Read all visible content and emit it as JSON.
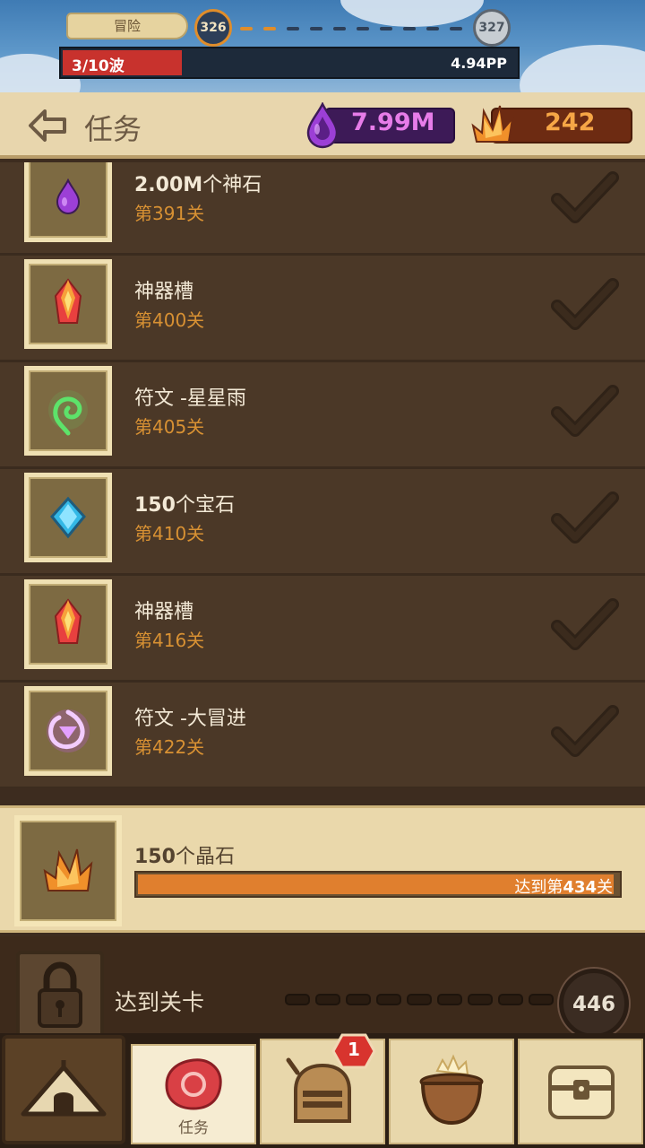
{
  "adventure": {
    "tag": "冒险",
    "current_level": "326",
    "next_level": "327",
    "wave": "3/10波",
    "wave_fraction": 0.3,
    "pp": "4.94PP"
  },
  "header": {
    "title": "任务",
    "purple_resource": "7.99M",
    "orange_resource": "242"
  },
  "quests": [
    {
      "title_bold": "2.00M",
      "title_rest": "个神石",
      "stage": "第391关",
      "icon": "purple-drop-icon",
      "done": true
    },
    {
      "title_bold": "",
      "title_rest": "神器槽",
      "stage": "第400关",
      "icon": "red-gem-icon",
      "done": true
    },
    {
      "title_bold": "",
      "title_rest": "符文 -星星雨",
      "stage": "第405关",
      "icon": "green-swirl-rune-icon",
      "done": true
    },
    {
      "title_bold": "150",
      "title_rest": "个宝石",
      "stage": "第410关",
      "icon": "blue-gem-icon",
      "done": true
    },
    {
      "title_bold": "",
      "title_rest": "神器槽",
      "stage": "第416关",
      "icon": "red-gem-icon",
      "done": true
    },
    {
      "title_bold": "",
      "title_rest": "符文 -大冒进",
      "stage": "第422关",
      "icon": "purple-rune-icon",
      "done": true
    }
  ],
  "current_quest": {
    "title_bold": "150",
    "title_rest": "个晶石",
    "progress_prefix": "达到第",
    "progress_level": "434",
    "progress_suffix": "关",
    "progress_fraction": 0.99
  },
  "unlock": {
    "label": "达到关卡",
    "level": "446"
  },
  "nav": {
    "active_label": "任务",
    "badge_count": "1"
  },
  "colors": {
    "accent_orange": "#e07f2e",
    "purple_value": "#e77ce9",
    "stage_text": "#d89133"
  }
}
